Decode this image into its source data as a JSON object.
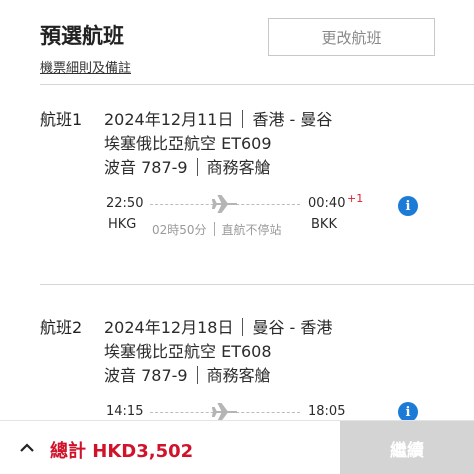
{
  "header": {
    "title": "預選航班",
    "change_button": "更改航班",
    "rules_link": "機票細則及備註"
  },
  "flights": [
    {
      "label": "航班1",
      "date": "2024年12月11日",
      "route": "香港 - 曼谷",
      "airline_flight": "埃塞俄比亞航空 ET609",
      "aircraft": "波音 787-9",
      "cabin": "商務客艙",
      "depart_time": "22:50",
      "arrive_time": "00:40",
      "day_offset": "+1",
      "depart_code": "HKG",
      "arrive_code": "BKK",
      "duration": "02時50分",
      "stops": "直航不停站"
    },
    {
      "label": "航班2",
      "date": "2024年12月18日",
      "route": "曼谷 - 香港",
      "airline_flight": "埃塞俄比亞航空 ET608",
      "aircraft": "波音 787-9",
      "cabin": "商務客艙",
      "depart_time": "14:15",
      "arrive_time": "18:05"
    }
  ],
  "footer": {
    "total_label": "總計 HKD3,502",
    "continue_button": "繼續"
  },
  "colors": {
    "price_red": "#d0122a",
    "info_blue": "#1c7bd6",
    "disabled_button": "#d4d4d4"
  },
  "icons": [
    "plane-icon",
    "info-icon",
    "chevron-up-icon"
  ]
}
